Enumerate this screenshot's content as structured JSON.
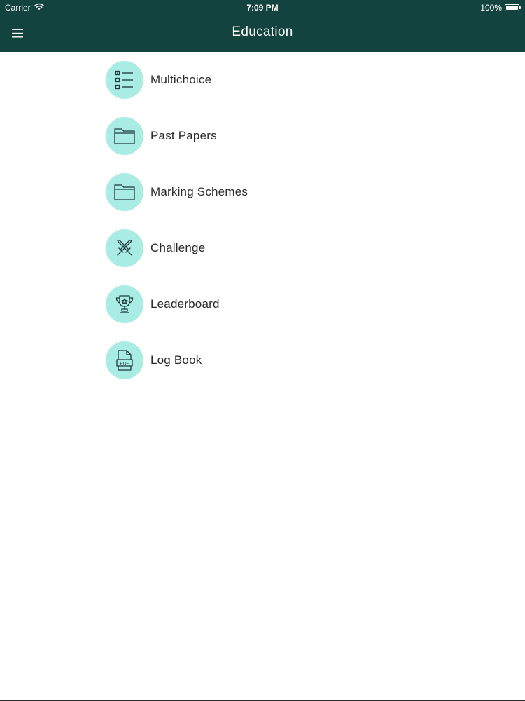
{
  "status_bar": {
    "carrier": "Carrier",
    "time": "7:09 PM",
    "battery": "100%"
  },
  "nav": {
    "title": "Education",
    "menu_icon": "hamburger-menu-icon"
  },
  "menu": {
    "items": [
      {
        "label": "Multichoice",
        "icon": "checklist-icon"
      },
      {
        "label": "Past Papers",
        "icon": "folder-icon"
      },
      {
        "label": "Marking Schemes",
        "icon": "folder-icon"
      },
      {
        "label": "Challenge",
        "icon": "crossed-swords-icon"
      },
      {
        "label": "Leaderboard",
        "icon": "trophy-icon"
      },
      {
        "label": "Log Book",
        "icon": "pdf-file-icon"
      }
    ]
  },
  "colors": {
    "header_bg": "#12433f",
    "icon_circle": "#a9ece3",
    "icon_stroke": "#1f3a3a",
    "text": "#2a2a2a"
  }
}
